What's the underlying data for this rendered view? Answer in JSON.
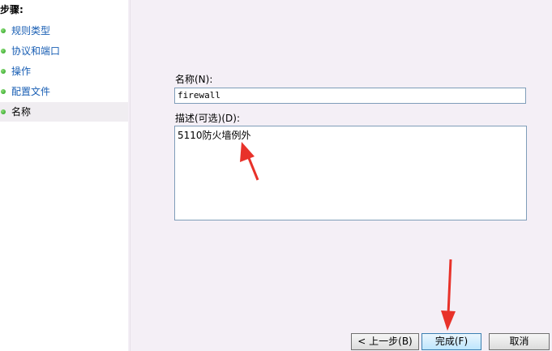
{
  "sidebar": {
    "title": "步骤:",
    "items": [
      {
        "label": "规则类型"
      },
      {
        "label": "协议和端口"
      },
      {
        "label": "操作"
      },
      {
        "label": "配置文件"
      },
      {
        "label": "名称"
      }
    ]
  },
  "form": {
    "name_label": "名称(N):",
    "name_value": "firewall",
    "desc_label": "描述(可选)(D):",
    "desc_value": "5110防火墙例外"
  },
  "buttons": {
    "back": "< 上一步(B)",
    "finish": "完成(F)",
    "cancel": "取消"
  },
  "colors": {
    "background": "#f4eff6",
    "link": "#1a5fb4",
    "step_done": "#1f9a1a",
    "arrow": "#e8322a"
  }
}
